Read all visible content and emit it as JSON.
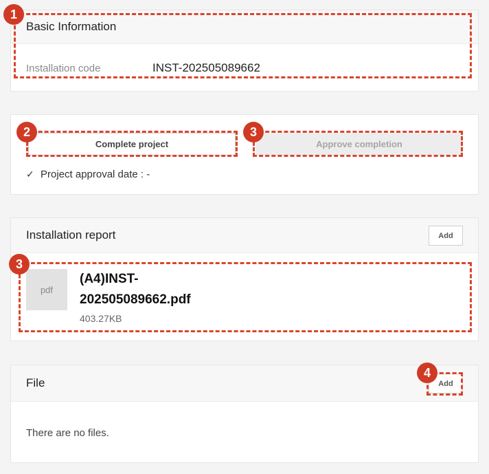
{
  "basic_info": {
    "title": "Basic Information",
    "installation_code_label": "Installation code",
    "installation_code_value": "INST-202505089662"
  },
  "project_actions": {
    "complete_label": "Complete project",
    "approve_label": "Approve completion",
    "approval_date_label": "Project approval date : -",
    "check_glyph": "✓"
  },
  "installation_report": {
    "title": "Installation report",
    "add_label": "Add",
    "file": {
      "type_label": "pdf",
      "name_line1": "(A4)INST-",
      "name_line2": "202505089662.pdf",
      "size": "403.27KB"
    }
  },
  "files": {
    "title": "File",
    "add_label": "Add",
    "empty_text": "There are no files."
  },
  "annotations": {
    "badge_1": "1",
    "badge_2": "2",
    "badge_3a": "3",
    "badge_3b": "3",
    "badge_4": "4",
    "highlight_color": "#d8452e",
    "badge_color": "#d03a24"
  }
}
